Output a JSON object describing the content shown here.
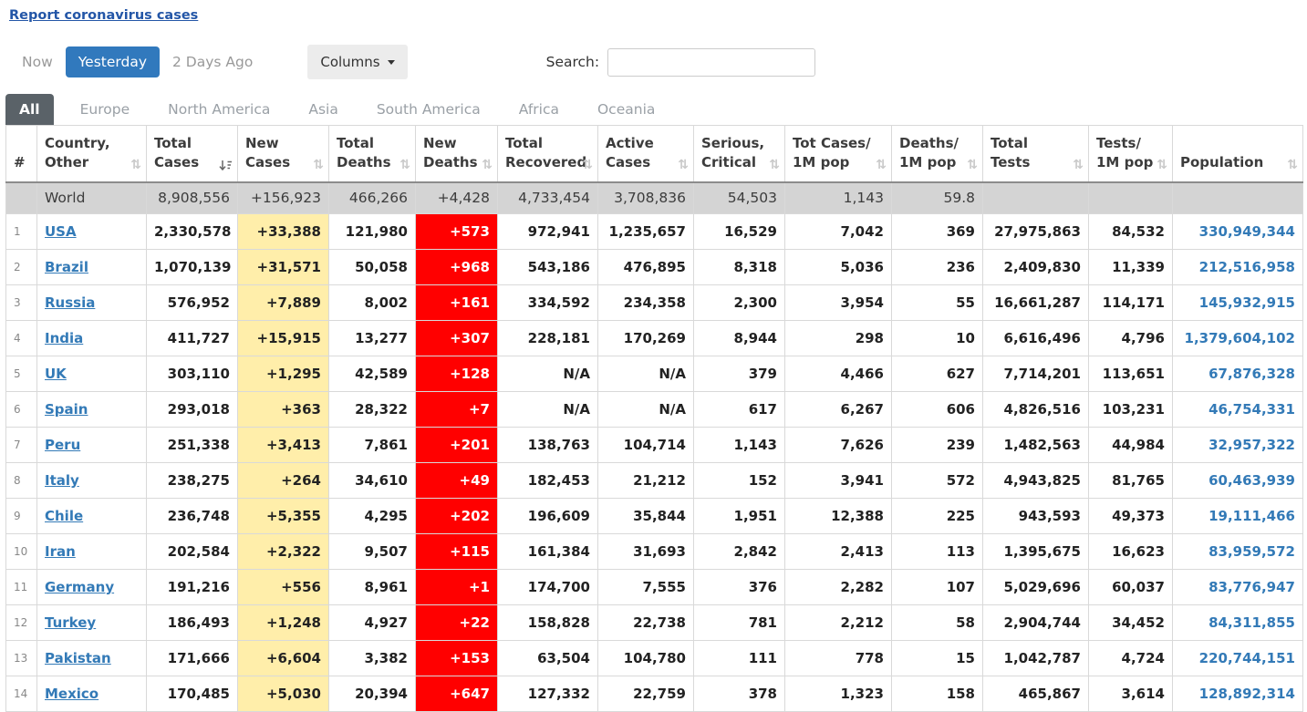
{
  "page": {
    "report_link": "Report coronavirus cases"
  },
  "toolbar": {
    "time_tabs": [
      {
        "label": "Now",
        "active": false
      },
      {
        "label": "Yesterday",
        "active": true
      },
      {
        "label": "2 Days Ago",
        "active": false
      }
    ],
    "columns_button": "Columns",
    "search_label": "Search:",
    "search_value": "",
    "search_placeholder": ""
  },
  "continent_tabs": [
    {
      "label": "All",
      "active": true
    },
    {
      "label": "Europe",
      "active": false
    },
    {
      "label": "North America",
      "active": false
    },
    {
      "label": "Asia",
      "active": false
    },
    {
      "label": "South America",
      "active": false
    },
    {
      "label": "Africa",
      "active": false
    },
    {
      "label": "Oceania",
      "active": false
    }
  ],
  "table": {
    "headers": [
      {
        "key": "rank",
        "lines": [
          "#"
        ],
        "sort": "none"
      },
      {
        "key": "country",
        "lines": [
          "Country,",
          "Other"
        ],
        "sort": "unsorted"
      },
      {
        "key": "total_cases",
        "lines": [
          "Total",
          "Cases"
        ],
        "sort": "desc"
      },
      {
        "key": "new_cases",
        "lines": [
          "New",
          "Cases"
        ],
        "sort": "unsorted"
      },
      {
        "key": "total_deaths",
        "lines": [
          "Total",
          "Deaths"
        ],
        "sort": "unsorted"
      },
      {
        "key": "new_deaths",
        "lines": [
          "New",
          "Deaths"
        ],
        "sort": "unsorted"
      },
      {
        "key": "total_recovered",
        "lines": [
          "Total",
          "Recovered"
        ],
        "sort": "unsorted"
      },
      {
        "key": "active_cases",
        "lines": [
          "Active",
          "Cases"
        ],
        "sort": "unsorted"
      },
      {
        "key": "serious_critical",
        "lines": [
          "Serious,",
          "Critical"
        ],
        "sort": "unsorted"
      },
      {
        "key": "cases_1m",
        "lines": [
          "Tot Cases/",
          "1M pop"
        ],
        "sort": "unsorted"
      },
      {
        "key": "deaths_1m",
        "lines": [
          "Deaths/",
          "1M pop"
        ],
        "sort": "unsorted"
      },
      {
        "key": "total_tests",
        "lines": [
          "Total",
          "Tests"
        ],
        "sort": "unsorted"
      },
      {
        "key": "tests_1m",
        "lines": [
          "Tests/",
          "1M pop"
        ],
        "sort": "unsorted"
      },
      {
        "key": "population",
        "lines": [
          "Population"
        ],
        "sort": "unsorted"
      }
    ],
    "world_row": {
      "rank": "",
      "country": "World",
      "total_cases": "8,908,556",
      "new_cases": "+156,923",
      "total_deaths": "466,266",
      "new_deaths": "+4,428",
      "total_recovered": "4,733,454",
      "active_cases": "3,708,836",
      "serious_critical": "54,503",
      "cases_1m": "1,143",
      "deaths_1m": "59.8",
      "total_tests": "",
      "tests_1m": "",
      "population": ""
    },
    "rows": [
      {
        "rank": "1",
        "country": "USA",
        "total_cases": "2,330,578",
        "new_cases": "+33,388",
        "total_deaths": "121,980",
        "new_deaths": "+573",
        "total_recovered": "972,941",
        "active_cases": "1,235,657",
        "serious_critical": "16,529",
        "cases_1m": "7,042",
        "deaths_1m": "369",
        "total_tests": "27,975,863",
        "tests_1m": "84,532",
        "population": "330,949,344"
      },
      {
        "rank": "2",
        "country": "Brazil",
        "total_cases": "1,070,139",
        "new_cases": "+31,571",
        "total_deaths": "50,058",
        "new_deaths": "+968",
        "total_recovered": "543,186",
        "active_cases": "476,895",
        "serious_critical": "8,318",
        "cases_1m": "5,036",
        "deaths_1m": "236",
        "total_tests": "2,409,830",
        "tests_1m": "11,339",
        "population": "212,516,958"
      },
      {
        "rank": "3",
        "country": "Russia",
        "total_cases": "576,952",
        "new_cases": "+7,889",
        "total_deaths": "8,002",
        "new_deaths": "+161",
        "total_recovered": "334,592",
        "active_cases": "234,358",
        "serious_critical": "2,300",
        "cases_1m": "3,954",
        "deaths_1m": "55",
        "total_tests": "16,661,287",
        "tests_1m": "114,171",
        "population": "145,932,915"
      },
      {
        "rank": "4",
        "country": "India",
        "total_cases": "411,727",
        "new_cases": "+15,915",
        "total_deaths": "13,277",
        "new_deaths": "+307",
        "total_recovered": "228,181",
        "active_cases": "170,269",
        "serious_critical": "8,944",
        "cases_1m": "298",
        "deaths_1m": "10",
        "total_tests": "6,616,496",
        "tests_1m": "4,796",
        "population": "1,379,604,102"
      },
      {
        "rank": "5",
        "country": "UK",
        "total_cases": "303,110",
        "new_cases": "+1,295",
        "total_deaths": "42,589",
        "new_deaths": "+128",
        "total_recovered": "N/A",
        "active_cases": "N/A",
        "serious_critical": "379",
        "cases_1m": "4,466",
        "deaths_1m": "627",
        "total_tests": "7,714,201",
        "tests_1m": "113,651",
        "population": "67,876,328"
      },
      {
        "rank": "6",
        "country": "Spain",
        "total_cases": "293,018",
        "new_cases": "+363",
        "total_deaths": "28,322",
        "new_deaths": "+7",
        "total_recovered": "N/A",
        "active_cases": "N/A",
        "serious_critical": "617",
        "cases_1m": "6,267",
        "deaths_1m": "606",
        "total_tests": "4,826,516",
        "tests_1m": "103,231",
        "population": "46,754,331"
      },
      {
        "rank": "7",
        "country": "Peru",
        "total_cases": "251,338",
        "new_cases": "+3,413",
        "total_deaths": "7,861",
        "new_deaths": "+201",
        "total_recovered": "138,763",
        "active_cases": "104,714",
        "serious_critical": "1,143",
        "cases_1m": "7,626",
        "deaths_1m": "239",
        "total_tests": "1,482,563",
        "tests_1m": "44,984",
        "population": "32,957,322"
      },
      {
        "rank": "8",
        "country": "Italy",
        "total_cases": "238,275",
        "new_cases": "+264",
        "total_deaths": "34,610",
        "new_deaths": "+49",
        "total_recovered": "182,453",
        "active_cases": "21,212",
        "serious_critical": "152",
        "cases_1m": "3,941",
        "deaths_1m": "572",
        "total_tests": "4,943,825",
        "tests_1m": "81,765",
        "population": "60,463,939"
      },
      {
        "rank": "9",
        "country": "Chile",
        "total_cases": "236,748",
        "new_cases": "+5,355",
        "total_deaths": "4,295",
        "new_deaths": "+202",
        "total_recovered": "196,609",
        "active_cases": "35,844",
        "serious_critical": "1,951",
        "cases_1m": "12,388",
        "deaths_1m": "225",
        "total_tests": "943,593",
        "tests_1m": "49,373",
        "population": "19,111,466"
      },
      {
        "rank": "10",
        "country": "Iran",
        "total_cases": "202,584",
        "new_cases": "+2,322",
        "total_deaths": "9,507",
        "new_deaths": "+115",
        "total_recovered": "161,384",
        "active_cases": "31,693",
        "serious_critical": "2,842",
        "cases_1m": "2,413",
        "deaths_1m": "113",
        "total_tests": "1,395,675",
        "tests_1m": "16,623",
        "population": "83,959,572"
      },
      {
        "rank": "11",
        "country": "Germany",
        "total_cases": "191,216",
        "new_cases": "+556",
        "total_deaths": "8,961",
        "new_deaths": "+1",
        "total_recovered": "174,700",
        "active_cases": "7,555",
        "serious_critical": "376",
        "cases_1m": "2,282",
        "deaths_1m": "107",
        "total_tests": "5,029,696",
        "tests_1m": "60,037",
        "population": "83,776,947"
      },
      {
        "rank": "12",
        "country": "Turkey",
        "total_cases": "186,493",
        "new_cases": "+1,248",
        "total_deaths": "4,927",
        "new_deaths": "+22",
        "total_recovered": "158,828",
        "active_cases": "22,738",
        "serious_critical": "781",
        "cases_1m": "2,212",
        "deaths_1m": "58",
        "total_tests": "2,904,744",
        "tests_1m": "34,452",
        "population": "84,311,855"
      },
      {
        "rank": "13",
        "country": "Pakistan",
        "total_cases": "171,666",
        "new_cases": "+6,604",
        "total_deaths": "3,382",
        "new_deaths": "+153",
        "total_recovered": "63,504",
        "active_cases": "104,780",
        "serious_critical": "111",
        "cases_1m": "778",
        "deaths_1m": "15",
        "total_tests": "1,042,787",
        "tests_1m": "4,724",
        "population": "220,744,151"
      },
      {
        "rank": "14",
        "country": "Mexico",
        "total_cases": "170,485",
        "new_cases": "+5,030",
        "total_deaths": "20,394",
        "new_deaths": "+647",
        "total_recovered": "127,332",
        "active_cases": "22,759",
        "serious_critical": "378",
        "cases_1m": "1,323",
        "deaths_1m": "158",
        "total_tests": "465,867",
        "tests_1m": "3,614",
        "population": "128,892,314"
      }
    ]
  },
  "colors": {
    "accent_blue": "#337ab7",
    "active_button_blue": "#3179bd",
    "active_tab_gray": "#5a6268",
    "new_cases_yellow": "#FFEEAA",
    "new_deaths_red": "#FF0000",
    "world_row_gray": "#d4d4d4"
  }
}
